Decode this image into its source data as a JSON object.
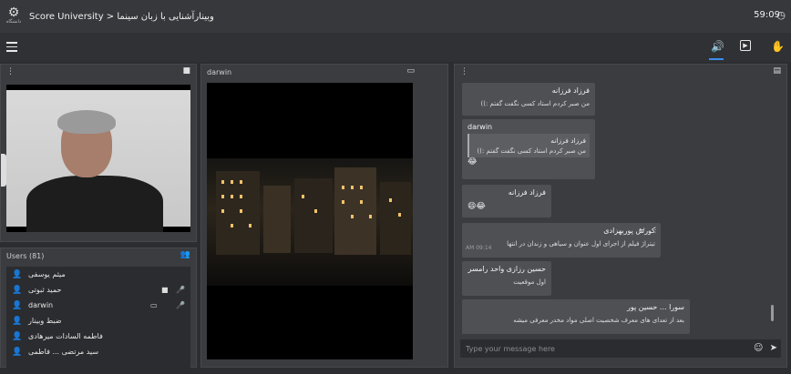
{
  "header": {
    "logo_text": "دانشگاه",
    "title": "Score University > وبینارآشنایی با زبان سینما",
    "timer": "59:09"
  },
  "toolbar": {
    "icons": [
      "menu-icon",
      "speaker-icon",
      "play-icon",
      "raise-hand-icon"
    ]
  },
  "webcam_panel": {
    "icon": "camera-icon"
  },
  "users_panel": {
    "title": "Users (81)",
    "users": [
      {
        "name": "میثم یوسفی",
        "color": "#e04848",
        "icons": []
      },
      {
        "name": "حمید ثبوتی",
        "color": "#3a8ee8",
        "icons": [
          "camera",
          "mic"
        ]
      },
      {
        "name": "darwin",
        "color": "#3a8ee8",
        "icons": [
          "screen",
          "mic"
        ]
      },
      {
        "name": "ضبط وبینار",
        "color": "#f2c230",
        "icons": []
      },
      {
        "name": "فاطمه السادات میرهادی",
        "color": "#f2c230",
        "icons": []
      },
      {
        "name": "سید مرتضی ... فاطمی",
        "color": "#f2c230",
        "icons": []
      }
    ]
  },
  "video_panel": {
    "title": "darwin",
    "icon": "screen-icon"
  },
  "chat_panel": {
    "messages": [
      {
        "who": "فرزاد فرزانه",
        "text": "من صبر کردم استاد کسی نگفت گفتم :))"
      },
      {
        "who": "darwin",
        "quote_who": "فرزاد فرزانه",
        "quote_text": "من صبر کردم استاد کسی نگفت گفتم :))",
        "emoji": "😂"
      },
      {
        "who": "فرزاد فرزانه",
        "emoji": "😄😂"
      },
      {
        "who": "کورش پوربهزادی",
        "text": "تیتراژ فیلم از اجرای اول عنوان و سیاهی و زندان در انتها",
        "time": "AM 09:14"
      },
      {
        "who": "حسین رزازی واحد رامسر",
        "text": "اول موقعیت"
      },
      {
        "who": "سورا ... حسین پور",
        "text": "بعد از تعدای های معرف شخصیت اصلی مواد مخدر معرفی میشه"
      }
    ],
    "input_placeholder": "Type your message here"
  }
}
